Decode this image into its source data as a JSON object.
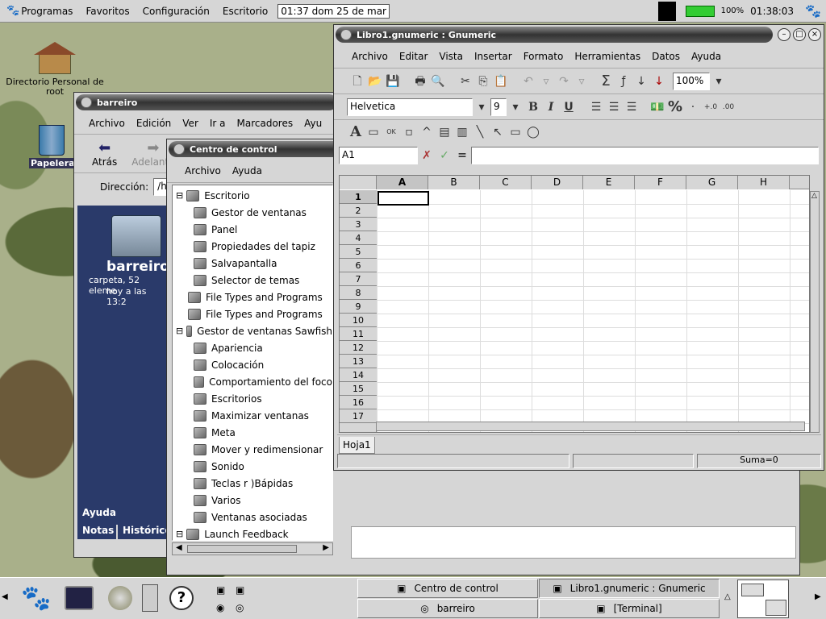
{
  "topbar": {
    "programs": "Programas",
    "favorites": "Favoritos",
    "config": "Configuración",
    "desktop": "Escritorio",
    "datetime": "01:37  dom 25 de mar",
    "battery": "100%",
    "clock": "01:38:03"
  },
  "desktop_icons": {
    "home_label": "Directorio Personal de root",
    "trash_label": "Papelera"
  },
  "nautilus": {
    "title": "barreiro",
    "menu": [
      "Archivo",
      "Edición",
      "Ver",
      "Ir a",
      "Marcadores",
      "Ayu"
    ],
    "back": "Atrás",
    "forward": "Adelante",
    "address_label": "Dirección:",
    "address_value": "/h",
    "folder_name": "barreiro",
    "folder_info1": "carpeta, 52 eleme",
    "folder_info2": "hoy a las 13:2",
    "tabs": {
      "help": "Ayuda",
      "notes": "Notas",
      "history": "Histórico"
    }
  },
  "control": {
    "title": "Centro de control",
    "menu": [
      "Archivo",
      "Ayuda"
    ],
    "tree": [
      {
        "label": "Escritorio",
        "level": 0,
        "expander": "minus"
      },
      {
        "label": "Gestor de ventanas",
        "level": 1
      },
      {
        "label": "Panel",
        "level": 1
      },
      {
        "label": "Propiedades del tapiz",
        "level": 1
      },
      {
        "label": "Salvapantalla",
        "level": 1
      },
      {
        "label": "Selector de temas",
        "level": 1
      },
      {
        "label": "File Types and Programs",
        "level": 0
      },
      {
        "label": "File Types and Programs",
        "level": 0
      },
      {
        "label": "Gestor de ventanas Sawfish",
        "level": 0,
        "expander": "minus"
      },
      {
        "label": "Apariencia",
        "level": 1
      },
      {
        "label": "Colocación",
        "level": 1
      },
      {
        "label": "Comportamiento del foco",
        "level": 1
      },
      {
        "label": "Escritorios",
        "level": 1
      },
      {
        "label": "Maximizar ventanas",
        "level": 1
      },
      {
        "label": "Meta",
        "level": 1
      },
      {
        "label": "Mover y redimensionar",
        "level": 1
      },
      {
        "label": "Sonido",
        "level": 1
      },
      {
        "label": "Teclas r )Bápidas",
        "level": 1
      },
      {
        "label": "Varios",
        "level": 1
      },
      {
        "label": "Ventanas asociadas",
        "level": 1
      },
      {
        "label": "Launch Feedback",
        "level": 0,
        "expander": "minus"
      }
    ]
  },
  "gnumeric": {
    "title": "Libro1.gnumeric : Gnumeric",
    "menu": [
      "Archivo",
      "Editar",
      "Vista",
      "Insertar",
      "Formato",
      "Herramientas",
      "Datos",
      "Ayuda"
    ],
    "zoom": "100%",
    "font": "Helvetica",
    "size": "9",
    "bold": "B",
    "italic": "I",
    "underline": "U",
    "percent": "%",
    "cellref": "A1",
    "equals": "=",
    "columns": [
      "A",
      "B",
      "C",
      "D",
      "E",
      "F",
      "G",
      "H"
    ],
    "rows": [
      "1",
      "2",
      "3",
      "4",
      "5",
      "6",
      "7",
      "8",
      "9",
      "10",
      "11",
      "12",
      "13",
      "14",
      "15",
      "16",
      "17"
    ],
    "sheet_tab": "Hoja1",
    "status_sum": "Suma=0"
  },
  "taskbar": {
    "tasks": [
      {
        "label": "Centro de control"
      },
      {
        "label": "Libro1.gnumeric : Gnumeric"
      },
      {
        "label": "barreiro"
      },
      {
        "label": "[Terminal]"
      }
    ]
  }
}
